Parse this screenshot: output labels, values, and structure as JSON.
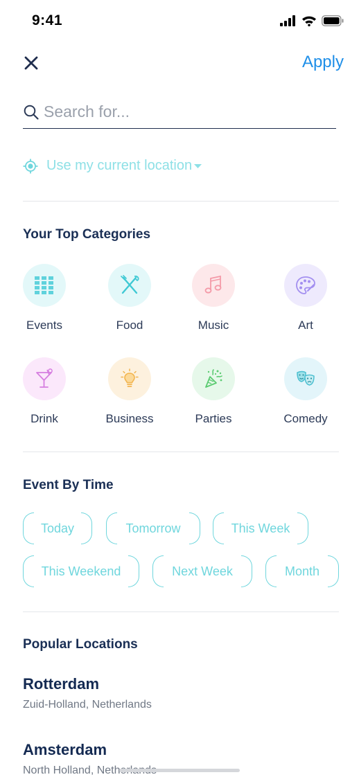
{
  "status_bar": {
    "time": "9:41"
  },
  "header": {
    "close_icon": "close-icon",
    "apply_label": "Apply"
  },
  "search": {
    "placeholder": "Search for...",
    "value": ""
  },
  "location": {
    "label": "Use my current location"
  },
  "top_categories": {
    "title": "Your Top Categories",
    "items": [
      {
        "label": "Events",
        "icon": "grid-icon",
        "color": "#e3f8f9"
      },
      {
        "label": "Food",
        "icon": "fork-knife-icon",
        "color": "#e3f8f9"
      },
      {
        "label": "Music",
        "icon": "music-note-icon",
        "color": "#fde8ea"
      },
      {
        "label": "Art",
        "icon": "palette-icon",
        "color": "#eeeafd"
      },
      {
        "label": "Drink",
        "icon": "cocktail-icon",
        "color": "#fbe8fb"
      },
      {
        "label": "Business",
        "icon": "lightbulb-icon",
        "color": "#fdf1de"
      },
      {
        "label": "Parties",
        "icon": "confetti-icon",
        "color": "#e6f8ea"
      },
      {
        "label": "Comedy",
        "icon": "theater-masks-icon",
        "color": "#e3f5fa"
      }
    ]
  },
  "event_by_time": {
    "title": "Event By Time",
    "chips": [
      "Today",
      "Tomorrow",
      "This Week",
      "This Weekend",
      "Next Week",
      "Month"
    ]
  },
  "popular_locations": {
    "title": "Popular Locations",
    "items": [
      {
        "name": "Rotterdam",
        "region": "Zuid-Holland, Netherlands"
      },
      {
        "name": "Amsterdam",
        "region": "North Holland, Netherlands"
      }
    ]
  },
  "colors": {
    "accent": "#1f8fe8",
    "teal": "#6fd6dd",
    "navy": "#1a2f55"
  }
}
